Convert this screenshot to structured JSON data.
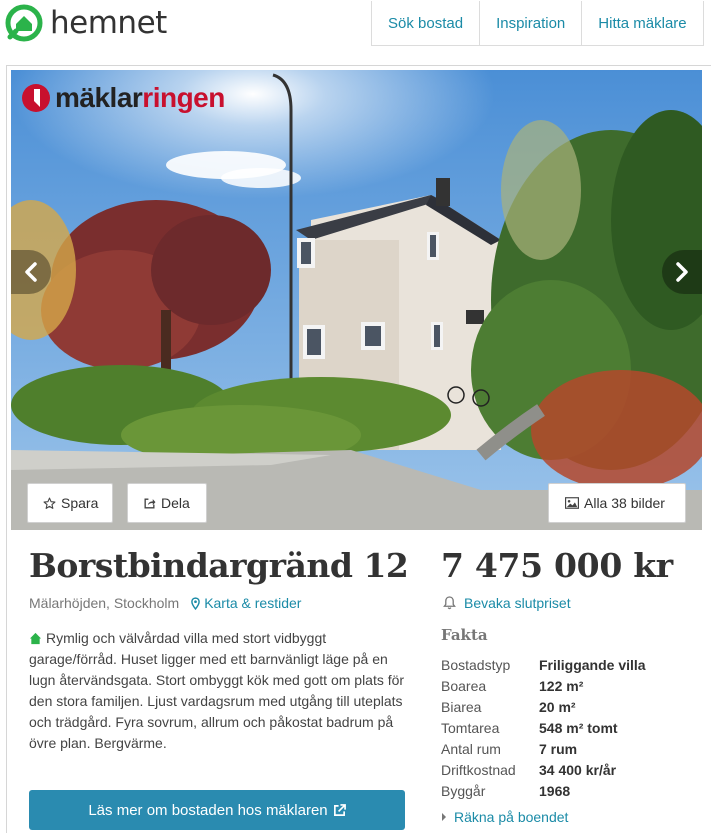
{
  "header": {
    "logo_text": "hemnet",
    "nav": [
      "Sök bostad",
      "Inspiration",
      "Hitta mäklare"
    ]
  },
  "broker": {
    "logo_part1": "mäklar",
    "logo_part2": "ringen"
  },
  "gallery": {
    "save_label": "Spara",
    "share_label": "Dela",
    "all_photos_label": "Alla 38 bilder"
  },
  "listing": {
    "address": "Borstbindargränd 12",
    "area": "Mälarhöjden, Stockholm",
    "map_link": "Karta & restider",
    "description": "Rymlig och välvårdad villa med stort vidbyggt garage/förråd. Huset ligger med ett barnvänligt läge på en lugn återvändsgata. Stort ombyggt kök med gott om plats för den stora familjen. Ljust vardagsrum med utgång till uteplats och trädgård. Fyra sovrum, allrum och påkostat badrum på övre plan. Bergvärme.",
    "cta_label": "Läs mer om bostaden hos mäklaren",
    "price": "7 475 000 kr",
    "watch_label": "Bevaka slutpriset",
    "facts_title": "Fakta",
    "facts": [
      {
        "label": "Bostadstyp",
        "value": "Friliggande villa"
      },
      {
        "label": "Boarea",
        "value": "122 m²"
      },
      {
        "label": "Biarea",
        "value": "20 m²"
      },
      {
        "label": "Tomtarea",
        "value": "548 m² tomt"
      },
      {
        "label": "Antal rum",
        "value": "7 rum"
      },
      {
        "label": "Driftkostnad",
        "value": "34 400 kr/år"
      },
      {
        "label": "Byggår",
        "value": "1968"
      }
    ],
    "calc_label": "Räkna på boendet"
  },
  "colors": {
    "brand_green": "#2bb34a",
    "link_blue": "#1b8ba7",
    "cta_blue": "#2a8bb0",
    "broker_red": "#c8102e"
  }
}
